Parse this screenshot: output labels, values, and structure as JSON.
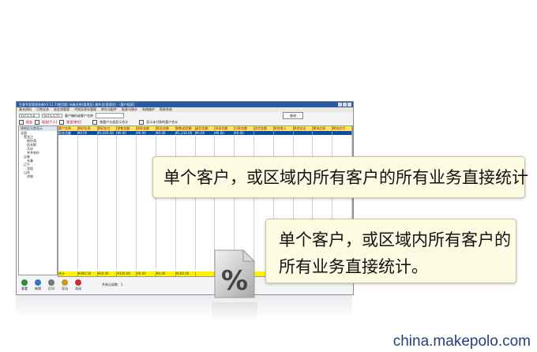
{
  "app": {
    "title": "生意专家管理系统V3.11.7(使用版)  电脑名称(管理员)  操作员(管理员) - [客户报表]",
    "menu": [
      "基本资料",
      "日常业务",
      "现金流管理",
      "代销及寄存管理",
      "库存与配件",
      "报表与统计",
      "系统维护",
      "帮助系统"
    ],
    "date_from": "2013-7-8",
    "date_to": "2013-7-22",
    "customer_label": "客户编码或客户名称",
    "query_label": "查询",
    "filters": [
      "现金",
      "现金[个人]",
      "现金[单位]"
    ],
    "options": [
      "按客户分组显示合计",
      "显示未付款的客户合计"
    ],
    "tree_header": "按地区分类显示",
    "tree_items": [
      "全国",
      "黑龙江",
      "哈尔滨",
      "佳木斯",
      "大庆",
      "齐齐哈尔",
      "吉林",
      "长春",
      "辽宁",
      "沈阳",
      "山东",
      "济南"
    ],
    "grid_headers": [
      "客户名称",
      "期初应收",
      "期初应付",
      "销售金额",
      "收款金额",
      "现金金额",
      "销售退货额",
      "退货金额",
      "折扣金额",
      "付款金额",
      "进货金额",
      "其他收入",
      "其他支出",
      "期末应收",
      "期末应付"
    ],
    "grid_row": [
      "现金总额",
      "¥0.00",
      "¥5,020.00",
      "¥0.00",
      "¥0.00",
      "¥0.00",
      "¥1,234.00",
      "¥0.00",
      "¥0.00",
      "¥0.00",
      "",
      "",
      "",
      "",
      ""
    ],
    "grid_total": [
      "合计",
      "¥490.50",
      "¥20.00",
      "¥320.00",
      "¥0.00",
      "¥0.00",
      "¥100.00",
      "",
      "",
      "",
      "",
      "",
      "",
      "",
      ""
    ],
    "bottom_buttons": [
      "查看",
      "新增",
      "打印",
      "导出",
      "关闭"
    ],
    "status": "共有记录数：1"
  },
  "callouts": {
    "first": "单个客户，或区域内所有客户的所有业务直接统计",
    "second_line1": "单个客户，或区域内所有客户的",
    "second_line2": "所有业务直接统计。"
  },
  "percent_icon": {
    "symbol": "%",
    "icon": "percent-file-icon"
  },
  "watermark": "china.makepolo.com",
  "colors": {
    "grid_header": "#ffe85c",
    "grid_row": "#0a4aa8",
    "grid_total": "#fff000",
    "callout_bg": "#fdfbe1"
  }
}
